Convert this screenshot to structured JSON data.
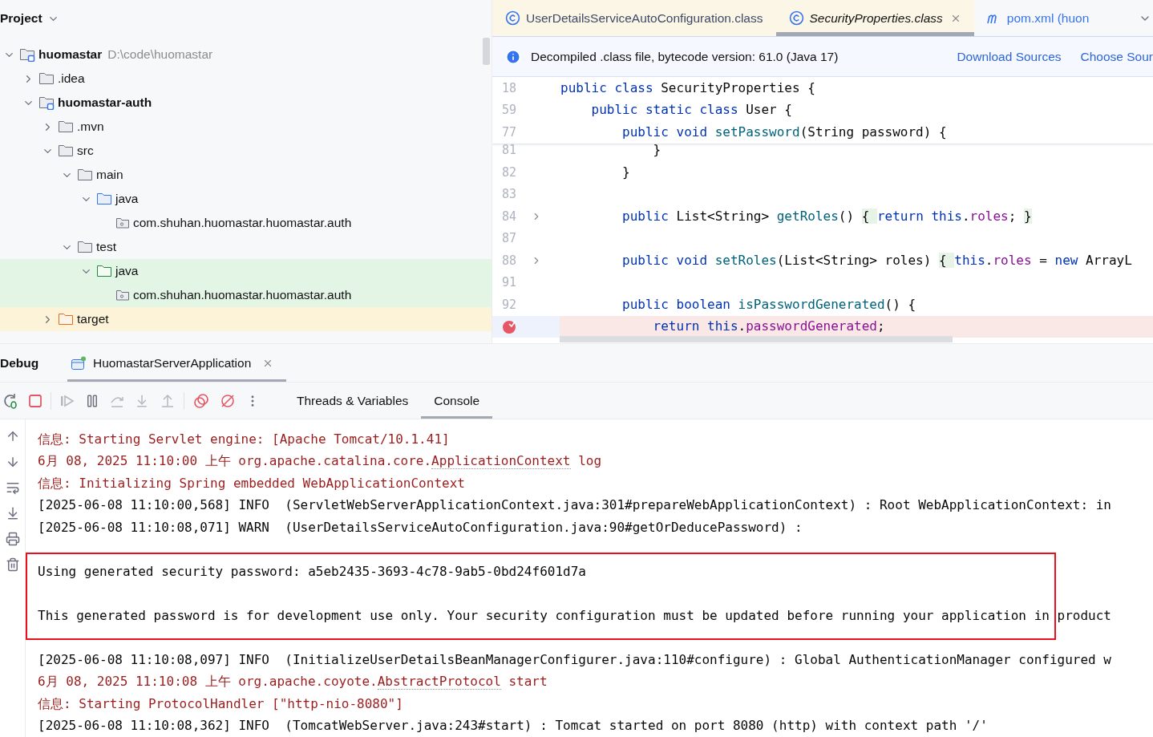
{
  "project_panel": {
    "title": "Project",
    "tree": [
      {
        "label": "huomastar",
        "kind": "module",
        "path": "D:\\code\\huomastar",
        "expanded": true,
        "children": [
          {
            "label": ".idea",
            "kind": "folder",
            "expanded": false
          },
          {
            "label": "huomastar-auth",
            "kind": "module",
            "expanded": true,
            "children": [
              {
                "label": ".mvn",
                "kind": "folder",
                "expanded": false
              },
              {
                "label": "src",
                "kind": "folder",
                "expanded": true,
                "children": [
                  {
                    "label": "main",
                    "kind": "folder",
                    "expanded": true,
                    "children": [
                      {
                        "label": "java",
                        "kind": "source",
                        "expanded": true,
                        "children": [
                          {
                            "label": "com.shuhan.huomastar.huomastar.auth",
                            "kind": "package"
                          }
                        ]
                      }
                    ]
                  },
                  {
                    "label": "test",
                    "kind": "folder",
                    "expanded": true,
                    "children": [
                      {
                        "label": "java",
                        "kind": "test-source",
                        "expanded": true,
                        "color": "#e3f6e5",
                        "children": [
                          {
                            "label": "com.shuhan.huomastar.huomastar.auth",
                            "kind": "package",
                            "color": "#e3f6e5"
                          }
                        ]
                      }
                    ]
                  }
                ]
              },
              {
                "label": "target",
                "kind": "excluded",
                "expanded": false,
                "color": "#fdf3d9"
              }
            ]
          }
        ]
      }
    ]
  },
  "editor": {
    "tabs": [
      {
        "label": "UserDetailsServiceAutoConfiguration.class",
        "kind": "class",
        "selected": false,
        "closable": false
      },
      {
        "label": "SecurityProperties.class",
        "kind": "class",
        "selected": true,
        "closable": true
      },
      {
        "label": "pom.xml (huon",
        "kind": "maven",
        "selected": false,
        "closable": false
      }
    ],
    "notice": {
      "text": "Decompiled .class file, bytecode version: 61.0 (Java 17)",
      "links": [
        "Download Sources",
        "Choose Sour"
      ]
    },
    "lines": [
      {
        "number": "18",
        "sticky": true,
        "tokens": [
          {
            "kind": "kw",
            "text": "public class "
          },
          {
            "kind": "text",
            "text": "SecurityProperties {"
          }
        ]
      },
      {
        "number": "59",
        "sticky": true,
        "tokens": [
          {
            "kind": "kw",
            "text": "    public static class "
          },
          {
            "kind": "text",
            "text": "User {"
          }
        ]
      },
      {
        "number": "77",
        "sticky": true,
        "tokens": [
          {
            "kind": "kw",
            "text": "        public void "
          },
          {
            "kind": "fn",
            "text": "setPassword"
          },
          {
            "kind": "text",
            "text": "(String password) {"
          }
        ]
      },
      {
        "number": "81",
        "tokens": [
          {
            "kind": "text",
            "text": "            }"
          }
        ]
      },
      {
        "number": "82",
        "tokens": [
          {
            "kind": "text",
            "text": "        }"
          }
        ]
      },
      {
        "number": "83"
      },
      {
        "number": "84",
        "foldable": true,
        "tokens": [
          {
            "kind": "kw",
            "text": "        public "
          },
          {
            "kind": "text",
            "text": "List<String> "
          },
          {
            "kind": "fn",
            "text": "getRoles"
          },
          {
            "kind": "text",
            "text": "() "
          },
          {
            "kind": "fold",
            "text": "{ "
          },
          {
            "kind": "kw",
            "text": "return this"
          },
          {
            "kind": "text",
            "text": "."
          },
          {
            "kind": "field",
            "text": "roles"
          },
          {
            "kind": "text",
            "text": "; "
          },
          {
            "kind": "fold",
            "text": "}"
          }
        ]
      },
      {
        "number": "87"
      },
      {
        "number": "88",
        "foldable": true,
        "tokens": [
          {
            "kind": "kw",
            "text": "        public void "
          },
          {
            "kind": "fn",
            "text": "setRoles"
          },
          {
            "kind": "text",
            "text": "(List<String> roles) "
          },
          {
            "kind": "fold",
            "text": "{ "
          },
          {
            "kind": "kw",
            "text": "this"
          },
          {
            "kind": "text",
            "text": "."
          },
          {
            "kind": "field",
            "text": "roles"
          },
          {
            "kind": "text",
            "text": " = "
          },
          {
            "kind": "kw",
            "text": "new "
          },
          {
            "kind": "text",
            "text": "ArrayL"
          }
        ]
      },
      {
        "number": "91"
      },
      {
        "number": "92",
        "tokens": [
          {
            "kind": "kw",
            "text": "        public boolean "
          },
          {
            "kind": "fn",
            "text": "isPasswordGenerated"
          },
          {
            "kind": "text",
            "text": "() {"
          }
        ]
      },
      {
        "breakpoint": true,
        "tokens": [
          {
            "kind": "kw",
            "text": "            return this"
          },
          {
            "kind": "text",
            "text": "."
          },
          {
            "kind": "field",
            "text": "passwordGenerated"
          },
          {
            "kind": "text",
            "text": ";"
          }
        ]
      }
    ]
  },
  "debug": {
    "title": "Debug",
    "session_tab": {
      "label": "HuomastarServerApplication",
      "selected": true
    },
    "tabs": [
      {
        "label": "Threads & Variables",
        "selected": false
      },
      {
        "label": "Console",
        "selected": true
      }
    ],
    "console": {
      "blocks": [
        {
          "framed": false,
          "lines": [
            {
              "kind": "stderr",
              "segments": [
                {
                  "text": "信息: Starting Servlet engine: [Apache Tomcat/10.1.41]"
                }
              ]
            },
            {
              "kind": "stderr",
              "segments": [
                {
                  "text": "6月 08, 2025 11:10:00 上午 org.apache.catalina.core."
                },
                {
                  "text": "ApplicationContext",
                  "link": true
                },
                {
                  "text": " log"
                }
              ]
            },
            {
              "kind": "stderr",
              "segments": [
                {
                  "text": "信息: Initializing Spring embedded WebApplicationContext"
                }
              ]
            },
            {
              "kind": "stdout",
              "segments": [
                {
                  "text": "[2025-06-08 11:10:00,568] INFO  (ServletWebServerApplicationContext.java:301#prepareWebApplicationContext) : Root WebApplicationContext: in"
                }
              ]
            },
            {
              "kind": "stdout",
              "segments": [
                {
                  "text": "[2025-06-08 11:10:08,071] WARN  (UserDetailsServiceAutoConfiguration.java:90#getOrDeducePassword) :"
                }
              ]
            }
          ]
        },
        {
          "framed": true,
          "lines": [
            {
              "kind": "stdout",
              "segments": [
                {
                  "text": "Using generated security password: a5eb2435-3693-4c78-9ab5-0bd24f601d7a"
                }
              ]
            },
            {
              "kind": "stdout",
              "segments": [
                {
                  "text": "This generated password is for development use only. Your security configuration must be updated before running your application in product"
                }
              ]
            }
          ]
        },
        {
          "framed": false,
          "lines": [
            {
              "kind": "stdout",
              "segments": [
                {
                  "text": "[2025-06-08 11:10:08,097] INFO  (InitializeUserDetailsBeanManagerConfigurer.java:110#configure) : Global AuthenticationManager configured w"
                }
              ]
            },
            {
              "kind": "stderr",
              "segments": [
                {
                  "text": "6月 08, 2025 11:10:08 上午 org.apache.coyote."
                },
                {
                  "text": "AbstractProtocol",
                  "link": true
                },
                {
                  "text": " start"
                }
              ]
            },
            {
              "kind": "stderr",
              "segments": [
                {
                  "text": "信息: Starting ProtocolHandler [\"http-nio-8080\"]"
                }
              ]
            },
            {
              "kind": "stdout",
              "segments": [
                {
                  "text": "[2025-06-08 11:10:08,362] INFO  (TomcatWebServer.java:243#start) : Tomcat started on port 8080 (http) with context path '/'"
                }
              ]
            }
          ]
        }
      ]
    }
  }
}
